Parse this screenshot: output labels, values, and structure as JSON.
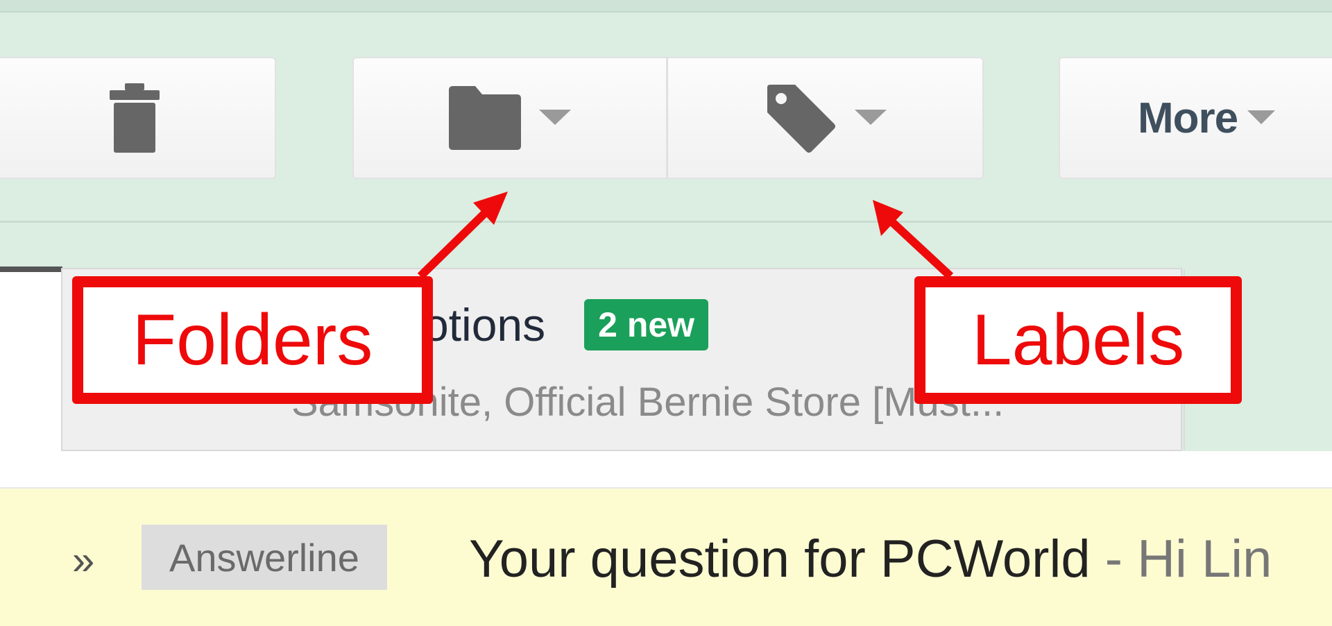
{
  "toolbar": {
    "delete_icon": "trash-icon",
    "folders_icon": "folder-icon",
    "labels_icon": "tag-icon",
    "more_label": "More",
    "icon_color": "#666666"
  },
  "promo_card": {
    "title": "otions",
    "badge": "2 new",
    "subtitle": "Samsonite, Official Bernie Store [Must..."
  },
  "email_row": {
    "marker": "»",
    "tag": "Answerline",
    "subject": "Your question for PCWorld",
    "snippet": " - Hi Lin"
  },
  "annotations": {
    "folders": "Folders",
    "labels": "Labels",
    "color": "#ee0a0a"
  }
}
